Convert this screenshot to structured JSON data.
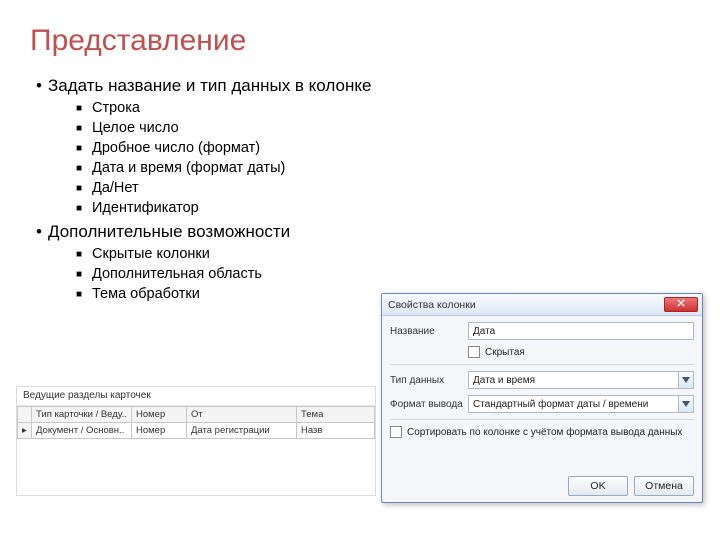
{
  "title": "Представление",
  "bullets": [
    {
      "text": "Задать название и тип данных в колонке",
      "items": [
        "Строка",
        "Целое число",
        "Дробное число (формат)",
        "Дата и время (формат даты)",
        "Да/Нет",
        "Идентификатор"
      ]
    },
    {
      "text": "Дополнительные возможности",
      "items": [
        "Скрытые колонки",
        "Дополнительная область",
        "Тема обработки"
      ]
    }
  ],
  "panel1": {
    "header": "Ведущие разделы карточек",
    "columns": [
      "Тип карточки / Веду..",
      "Номер",
      "От",
      "Тема"
    ],
    "row": [
      "Документ / Основн..",
      "Номер",
      "Дата регистрации",
      "Назв"
    ]
  },
  "panel2": {
    "title": "Свойства колонки",
    "name_label": "Название",
    "name_value": "Дата",
    "hidden_label": "Скрытая",
    "type_label": "Тип данных",
    "type_value": "Дата и время",
    "format_label": "Формат вывода",
    "format_value": "Стандартный формат даты / времени",
    "sort_label": "Сортировать по колонке с учётом формата вывода данных",
    "ok": "OK",
    "cancel": "Отмена"
  }
}
